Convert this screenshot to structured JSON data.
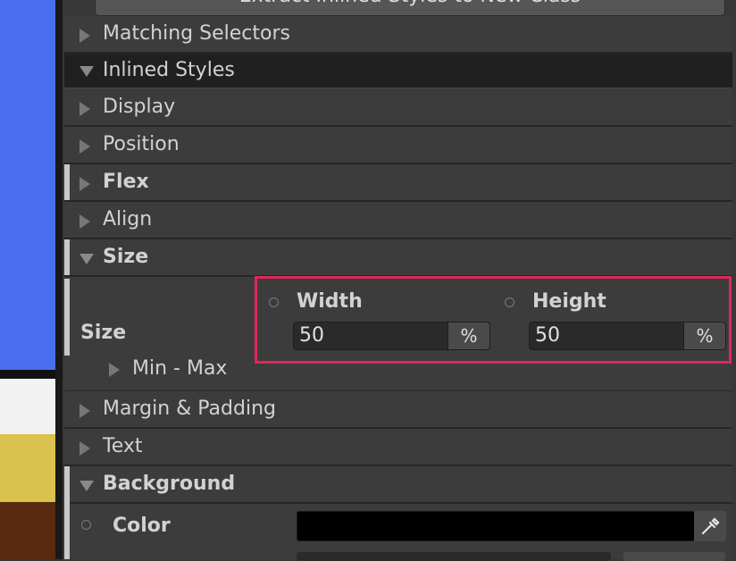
{
  "extract_button_label": "Extract Inlined Styles to New Class",
  "sections": [
    {
      "label": "Matching Selectors",
      "expanded": false,
      "bold": false
    },
    {
      "label": "Inlined Styles",
      "expanded": true,
      "bold": false
    },
    {
      "label": "Display",
      "expanded": false,
      "bold": false
    },
    {
      "label": "Position",
      "expanded": false,
      "bold": false
    },
    {
      "label": "Flex",
      "expanded": false,
      "bold": true
    },
    {
      "label": "Align",
      "expanded": false,
      "bold": false
    },
    {
      "label": "Size",
      "expanded": true,
      "bold": true
    }
  ],
  "size": {
    "row_label": "Size",
    "width_label": "Width",
    "width_value": "50",
    "width_unit": "%",
    "height_label": "Height",
    "height_value": "50",
    "height_unit": "%",
    "min_max_label": "Min - Max"
  },
  "after_sections": [
    {
      "label": "Margin & Padding",
      "expanded": false,
      "bold": false
    },
    {
      "label": "Text",
      "expanded": false,
      "bold": false
    },
    {
      "label": "Background",
      "expanded": true,
      "bold": true
    }
  ],
  "background": {
    "color_label": "Color",
    "color_value": "#000000"
  },
  "colors": {
    "highlight": "#e2265a",
    "scene_blue": "#4a6ef0",
    "scene_yellow": "#d9c24d",
    "scene_brown": "#5a2a10"
  }
}
